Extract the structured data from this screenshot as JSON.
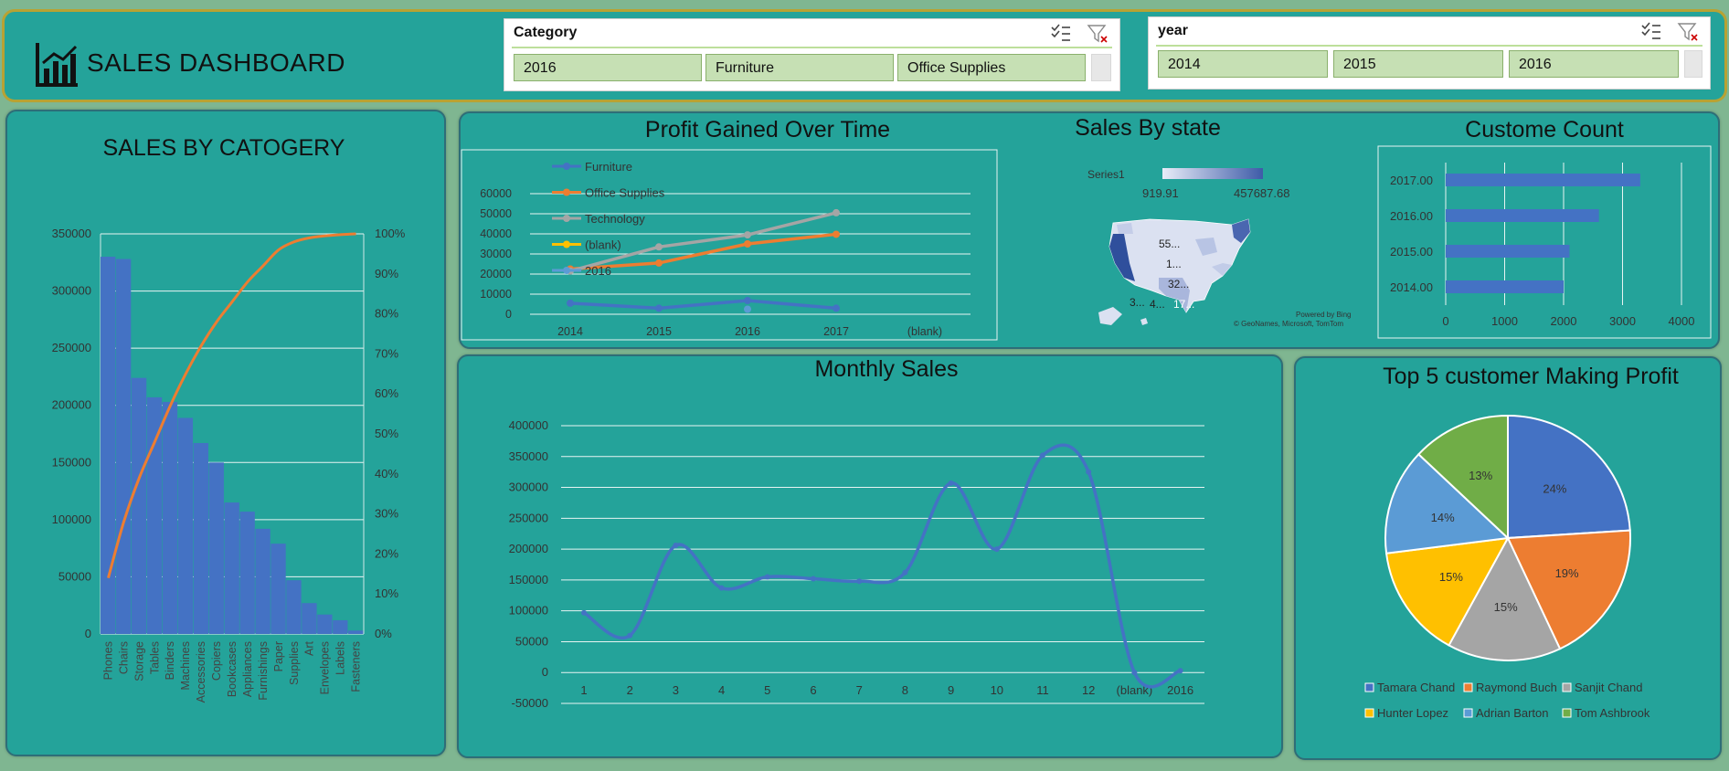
{
  "header": {
    "title": "SALES DASHBOARD",
    "slicers": [
      {
        "title": "Category",
        "items": [
          "2016",
          "Furniture",
          "Office Supplies"
        ]
      },
      {
        "title": "year",
        "items": [
          "2014",
          "2015",
          "2016"
        ]
      }
    ]
  },
  "colors": {
    "bg": "#24a39a",
    "blue": "#4472c4",
    "orange": "#ed7d31",
    "gray": "#a5a5a5",
    "yellow": "#ffc000",
    "lightblue": "#5b9bd5",
    "green": "#70ad47"
  },
  "charts": [
    {
      "title": "SALES BY CATOGERY",
      "type": "bar",
      "categories": [
        "Phones",
        "Chairs",
        "Storage",
        "Tables",
        "Binders",
        "Machines",
        "Accessories",
        "Copiers",
        "Bookcases",
        "Appliances",
        "Furnishings",
        "Paper",
        "Supplies",
        "Art",
        "Envelopes",
        "Labels",
        "Fasteners"
      ],
      "series": [
        {
          "type": "bar",
          "values": [
            330000,
            328000,
            224000,
            207000,
            203000,
            189000,
            167000,
            150000,
            115000,
            107000,
            92000,
            79000,
            47000,
            27000,
            17000,
            12000,
            3000
          ]
        },
        {
          "type": "line",
          "values": [
            14,
            28,
            39,
            48,
            57,
            65,
            72,
            78,
            83,
            88,
            92,
            96,
            98,
            99,
            99.5,
            99.8,
            100
          ]
        }
      ],
      "y_ticks": [
        "0",
        "50000",
        "100000",
        "150000",
        "200000",
        "250000",
        "300000",
        "350000"
      ],
      "y2_ticks": [
        "0%",
        "10%",
        "20%",
        "30%",
        "40%",
        "50%",
        "60%",
        "70%",
        "80%",
        "90%",
        "100%"
      ],
      "ylim": [
        0,
        350000
      ],
      "y2lim": [
        0,
        100
      ]
    },
    {
      "title": "Profit Gained Over Time",
      "type": "line",
      "categories": [
        "2014",
        "2015",
        "2016",
        "2017",
        "(blank)"
      ],
      "series": [
        {
          "name": "Furniture",
          "values": [
            5500,
            3000,
            6800,
            3000
          ]
        },
        {
          "name": "Office Supplies",
          "values": [
            22500,
            25500,
            35000,
            39800
          ]
        },
        {
          "name": "Technology",
          "values": [
            21500,
            33500,
            39500,
            50500
          ]
        },
        {
          "name": "(blank)",
          "values": []
        },
        {
          "name": "2016",
          "values": [
            null,
            null,
            2500,
            null
          ]
        }
      ],
      "y_ticks": [
        "0",
        "10000",
        "20000",
        "30000",
        "40000",
        "50000",
        "60000"
      ],
      "ylim": [
        0,
        60000
      ]
    },
    {
      "title": "Sales By state",
      "type": "map",
      "legend_label": "Series1",
      "min_label": "919.91",
      "max_label": "457687.68",
      "map_labels": [
        "55...",
        "1...",
        "32...",
        "3...",
        "4...",
        "17..."
      ],
      "credit_1": "Powered by Bing",
      "credit_2": "© GeoNames, Microsoft, TomTom"
    },
    {
      "title": "Custome Count",
      "type": "bar",
      "categories": [
        "2017.00",
        "2016.00",
        "2015.00",
        "2014.00"
      ],
      "values": [
        3300,
        2600,
        2100,
        2000
      ],
      "x_ticks": [
        "0",
        "1000",
        "2000",
        "3000",
        "4000"
      ],
      "xlim": [
        0,
        4000
      ]
    },
    {
      "title": "Monthly Sales",
      "type": "line",
      "categories": [
        "1",
        "2",
        "3",
        "4",
        "5",
        "6",
        "7",
        "8",
        "9",
        "10",
        "11",
        "12",
        "(blank)",
        "2016"
      ],
      "values": [
        97000,
        60000,
        206000,
        137000,
        155000,
        152000,
        148000,
        162000,
        307000,
        200000,
        352000,
        325000,
        0,
        3000
      ],
      "y_ticks": [
        "-50000",
        "0",
        "50000",
        "100000",
        "150000",
        "200000",
        "250000",
        "300000",
        "350000",
        "400000"
      ],
      "ylim": [
        -50000,
        400000
      ]
    },
    {
      "title": "Top 5 customer Making Profit",
      "type": "pie",
      "slices": [
        {
          "name": "Tamara Chand",
          "value": 24,
          "label": "24%"
        },
        {
          "name": "Raymond Buch",
          "value": 19,
          "label": "19%"
        },
        {
          "name": "Sanjit Chand",
          "value": 15,
          "label": "15%"
        },
        {
          "name": "Hunter Lopez",
          "value": 15,
          "label": "15%"
        },
        {
          "name": "Adrian Barton",
          "value": 14,
          "label": "14%"
        },
        {
          "name": "Tom Ashbrook",
          "value": 13,
          "label": "13%"
        }
      ]
    }
  ]
}
